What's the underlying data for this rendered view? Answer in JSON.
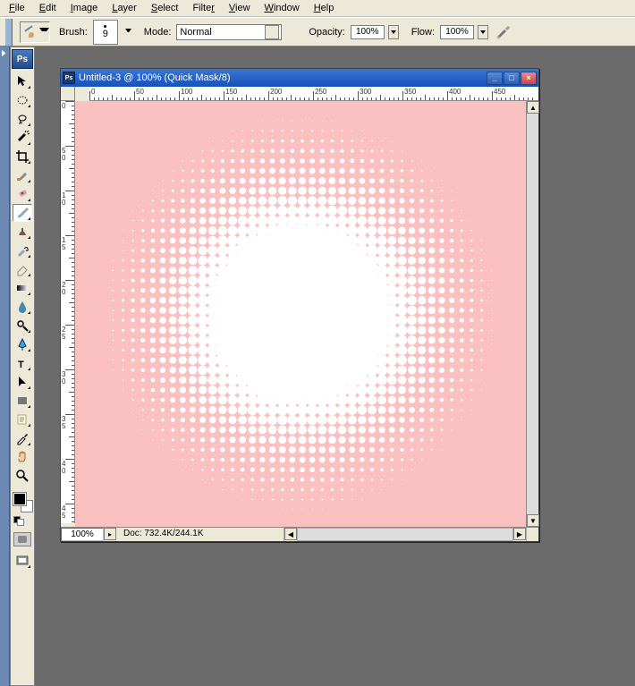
{
  "menu": {
    "file": "File",
    "edit": "Edit",
    "image": "Image",
    "layer": "Layer",
    "select": "Select",
    "filter": "Filter",
    "view": "View",
    "window": "Window",
    "help": "Help"
  },
  "options": {
    "brush_label": "Brush:",
    "brush_size": "9",
    "mode_label": "Mode:",
    "mode_value": "Normal",
    "opacity_label": "Opacity:",
    "opacity_value": "100%",
    "flow_label": "Flow:",
    "flow_value": "100%"
  },
  "doc": {
    "title": "Untitled-3 @ 100% (Quick Mask/8)",
    "zoom": "100%",
    "info": "Doc: 732.4K/244.1K"
  },
  "ruler_h": [
    "0",
    "50",
    "100",
    "150",
    "200",
    "250",
    "300",
    "350",
    "400",
    "450"
  ],
  "ruler_v": [
    "0",
    "5",
    "1",
    "1",
    "2",
    "2",
    "3",
    "3",
    "4",
    "4"
  ],
  "ruler_v2": [
    "",
    "0",
    "0",
    "5",
    "0",
    "5",
    "0",
    "5",
    "0",
    "5"
  ],
  "colors": {
    "quickmask": "#fbc1c1"
  }
}
